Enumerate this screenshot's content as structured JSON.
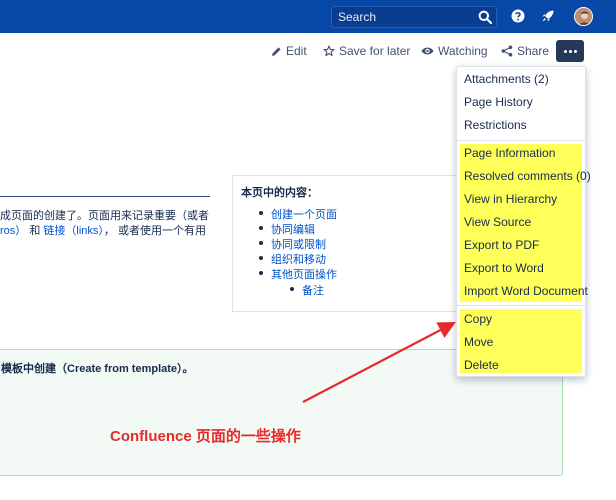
{
  "header": {
    "search_placeholder": "Search"
  },
  "actions": {
    "edit": "Edit",
    "save_for_later": "Save for later",
    "watching": "Watching",
    "share": "Share"
  },
  "content": {
    "line1": "成页面的创建了。页面用来记录重要（或者",
    "line2_link1": "ros）",
    "line2_and": " 和 ",
    "line2_link2": "链接（links）",
    "line2_rest": "，  或者使用一个有用",
    "panel_text": "模板中创建（Create from template）。"
  },
  "toc": {
    "title": "本页中的内容：",
    "items": [
      "创建一个页面",
      "协同编辑",
      "协同或限制",
      "组织和移动",
      "其他页面操作",
      "备注"
    ]
  },
  "menu": {
    "group1": [
      "Attachments (2)",
      "Page History",
      "Restrictions"
    ],
    "group2": [
      "Page Information",
      "Resolved comments (0)",
      "View in Hierarchy",
      "View Source",
      "Export to PDF",
      "Export to Word",
      "Import Word Document"
    ],
    "group3": [
      "Copy",
      "Move",
      "Delete"
    ]
  },
  "annotation": "Confluence 页面的一些操作",
  "colors": {
    "topbar": "#0747a6",
    "highlight": "#ffff5a",
    "annotation": "#e52b2b",
    "link": "#0052cc"
  }
}
